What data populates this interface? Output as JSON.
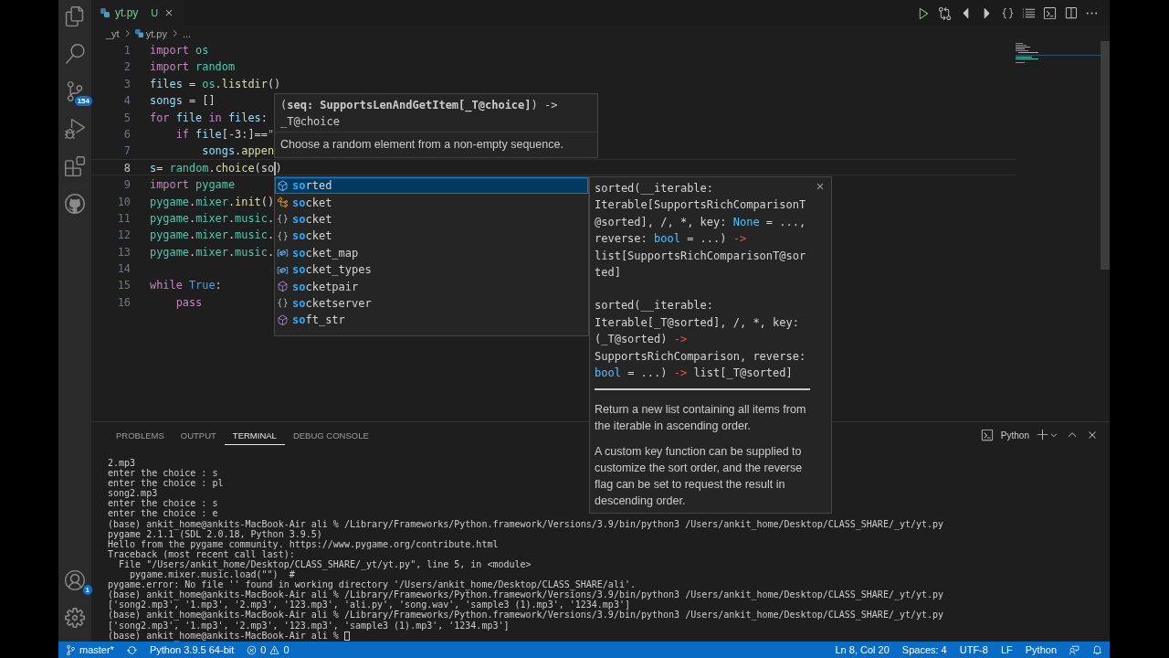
{
  "activity_bar": {
    "source_control_badge": "154",
    "accounts_badge": "1"
  },
  "tabs": [
    {
      "label": "yt.py",
      "status": "U",
      "selected": true
    }
  ],
  "breadcrumb": [
    "_yt",
    "yt.py",
    "..."
  ],
  "editor": {
    "lines": [
      {
        "number": "1",
        "current": false,
        "tokens": [
          {
            "kind": "keyword",
            "text": "import"
          },
          {
            "kind": "module",
            "text": " os"
          }
        ]
      },
      {
        "number": "2",
        "current": false,
        "tokens": [
          {
            "kind": "keyword",
            "text": "import"
          },
          {
            "kind": "module",
            "text": " random"
          }
        ]
      },
      {
        "number": "3",
        "current": false,
        "tokens": [
          {
            "kind": "variable",
            "text": "files"
          },
          {
            "kind": "plain",
            "text": " = "
          },
          {
            "kind": "module",
            "text": "os"
          },
          {
            "kind": "plain",
            "text": "."
          },
          {
            "kind": "function",
            "text": "listdir"
          },
          {
            "kind": "plain",
            "text": "()"
          }
        ]
      },
      {
        "number": "4",
        "current": false,
        "tokens": [
          {
            "kind": "variable",
            "text": "songs"
          },
          {
            "kind": "plain",
            "text": " = []"
          }
        ]
      },
      {
        "number": "5",
        "current": false,
        "tokens": [
          {
            "kind": "keyword",
            "text": "for"
          },
          {
            "kind": "variable",
            "text": " file"
          },
          {
            "kind": "keyword",
            "text": " in"
          },
          {
            "kind": "variable",
            "text": " files"
          },
          {
            "kind": "plain",
            "text": ":"
          }
        ]
      },
      {
        "number": "6",
        "current": false,
        "tokens": [
          {
            "kind": "keyword",
            "text": "    if"
          },
          {
            "kind": "variable",
            "text": " file"
          },
          {
            "kind": "plain",
            "text": "[-3:]=="
          },
          {
            "kind": "string",
            "text": "\""
          }
        ]
      },
      {
        "number": "7",
        "current": false,
        "tokens": [
          {
            "kind": "variable",
            "text": "        songs"
          },
          {
            "kind": "plain",
            "text": "."
          },
          {
            "kind": "function",
            "text": "appen"
          }
        ]
      },
      {
        "number": "8",
        "current": true,
        "tokens": [
          {
            "kind": "variable",
            "text": "s"
          },
          {
            "kind": "plain",
            "text": "= "
          },
          {
            "kind": "module",
            "text": "random"
          },
          {
            "kind": "plain",
            "text": "."
          },
          {
            "kind": "function",
            "text": "choice"
          },
          {
            "kind": "plain",
            "text": "(so"
          },
          {
            "kind": "cursor"
          },
          {
            "kind": "plain",
            "text": ")"
          }
        ]
      },
      {
        "number": "9",
        "current": false,
        "tokens": [
          {
            "kind": "keyword",
            "text": "import"
          },
          {
            "kind": "module",
            "text": " pygame"
          }
        ]
      },
      {
        "number": "10",
        "current": false,
        "tokens": [
          {
            "kind": "module",
            "text": "pygame"
          },
          {
            "kind": "plain",
            "text": "."
          },
          {
            "kind": "module",
            "text": "mixer"
          },
          {
            "kind": "plain",
            "text": "."
          },
          {
            "kind": "function",
            "text": "init"
          },
          {
            "kind": "plain",
            "text": "()"
          }
        ]
      },
      {
        "number": "11",
        "current": false,
        "tokens": [
          {
            "kind": "module",
            "text": "pygame"
          },
          {
            "kind": "plain",
            "text": "."
          },
          {
            "kind": "module",
            "text": "mixer"
          },
          {
            "kind": "plain",
            "text": "."
          },
          {
            "kind": "module",
            "text": "music"
          },
          {
            "kind": "plain",
            "text": "."
          }
        ]
      },
      {
        "number": "12",
        "current": false,
        "tokens": [
          {
            "kind": "module",
            "text": "pygame"
          },
          {
            "kind": "plain",
            "text": "."
          },
          {
            "kind": "module",
            "text": "mixer"
          },
          {
            "kind": "plain",
            "text": "."
          },
          {
            "kind": "module",
            "text": "music"
          },
          {
            "kind": "plain",
            "text": "."
          }
        ]
      },
      {
        "number": "13",
        "current": false,
        "tokens": [
          {
            "kind": "module",
            "text": "pygame"
          },
          {
            "kind": "plain",
            "text": "."
          },
          {
            "kind": "module",
            "text": "mixer"
          },
          {
            "kind": "plain",
            "text": "."
          },
          {
            "kind": "module",
            "text": "music"
          },
          {
            "kind": "plain",
            "text": "."
          }
        ]
      },
      {
        "number": "14",
        "current": false
      },
      {
        "number": "15",
        "current": false,
        "tokens": [
          {
            "kind": "keyword",
            "text": "while"
          },
          {
            "kind": "constant",
            "text": " True"
          },
          {
            "kind": "plain",
            "text": ":"
          }
        ]
      },
      {
        "number": "16",
        "current": false,
        "tokens": [
          {
            "kind": "keyword",
            "text": "    pass"
          }
        ]
      }
    ]
  },
  "signature_help": {
    "signature": "(**seq: SupportsLenAndGetItem[_T@choice]**) -> _T@choice",
    "description": "Choose a random element from a non-empty sequence."
  },
  "suggestions": [
    {
      "match": "so",
      "rest": "rted",
      "kind": "method",
      "selected": true
    },
    {
      "match": "so",
      "rest": "cket",
      "kind": "class",
      "selected": false
    },
    {
      "match": "so",
      "rest": "cket",
      "kind": "module",
      "selected": false
    },
    {
      "match": "so",
      "rest": "cket",
      "kind": "module",
      "selected": false
    },
    {
      "match": "so",
      "rest": "cket_map",
      "kind": "variable",
      "selected": false
    },
    {
      "match": "so",
      "rest": "cket_types",
      "kind": "variable",
      "selected": false
    },
    {
      "match": "so",
      "rest": "cketpair",
      "kind": "method",
      "selected": false
    },
    {
      "match": "so",
      "rest": "cketserver",
      "kind": "module",
      "selected": false
    },
    {
      "match": "so",
      "rest": "ft_str",
      "kind": "method",
      "selected": false
    }
  ],
  "suggestion_details": {
    "signatures": [
      [
        [
          {
            "kind": "plain",
            "text": "sorted(__iterable:"
          }
        ],
        [
          {
            "kind": "plain",
            "text": "Iterable[SupportsRichComparisonT"
          }
        ],
        [
          {
            "kind": "plain",
            "text": "@sorted], /, *, key: "
          },
          {
            "kind": "type",
            "text": "None"
          },
          {
            "kind": "plain",
            "text": " = ...,"
          }
        ],
        [
          {
            "kind": "plain",
            "text": "reverse: "
          },
          {
            "kind": "type",
            "text": "bool"
          },
          {
            "kind": "plain",
            "text": " = ...) "
          },
          {
            "kind": "arrow",
            "text": "->"
          }
        ],
        [
          {
            "kind": "plain",
            "text": "list[SupportsRichComparisonT@sor"
          }
        ],
        [
          {
            "kind": "plain",
            "text": "ted]"
          }
        ]
      ],
      [
        [
          {
            "kind": "plain",
            "text": "sorted(__iterable:"
          }
        ],
        [
          {
            "kind": "plain",
            "text": "Iterable[_T@sorted], /, *, key:"
          }
        ],
        [
          {
            "kind": "plain",
            "text": "(_T@sorted) "
          },
          {
            "kind": "arrow",
            "text": "->"
          }
        ],
        [
          {
            "kind": "plain",
            "text": "SupportsRichComparison, reverse:"
          }
        ],
        [
          {
            "kind": "type",
            "text": "bool"
          },
          {
            "kind": "plain",
            "text": " = ...) "
          },
          {
            "kind": "arrow",
            "text": "->"
          },
          {
            "kind": "plain",
            "text": " list[_T@sorted]"
          }
        ]
      ]
    ],
    "paragraphs": [
      "Return a new list containing all items from the iterable in ascending order.",
      "A custom key function can be supplied to customize the sort order, and the reverse flag can be set to request the result in descending order."
    ]
  },
  "panel": {
    "tabs": [
      {
        "label": "PROBLEMS",
        "selected": false
      },
      {
        "label": "OUTPUT",
        "selected": false
      },
      {
        "label": "TERMINAL",
        "selected": true
      },
      {
        "label": "DEBUG CONSOLE",
        "selected": false
      }
    ],
    "terminal_name": "Python",
    "terminal_lines": [
      "2.mp3",
      "enter the choice : s",
      "enter the choice : pl",
      "song2.mp3",
      "enter the choice : s",
      "enter the choice : e",
      "(base) ankit_home@ankits-MacBook-Air ali % /Library/Frameworks/Python.framework/Versions/3.9/bin/python3 /Users/ankit_home/Desktop/CLASS_SHARE/_yt/yt.py",
      "pygame 2.1.1 (SDL 2.0.18, Python 3.9.5)",
      "Hello from the pygame community. https://www.pygame.org/contribute.html",
      "Traceback (most recent call last):",
      "  File \"/Users/ankit_home/Desktop/CLASS_SHARE/_yt/yt.py\", line 5, in <module>",
      "    pygame.mixer.music.load(\"\")  #",
      "pygame.error: No file '' found in working directory '/Users/ankit_home/Desktop/CLASS_SHARE/ali'.",
      "(base) ankit_home@ankits-MacBook-Air ali % /Library/Frameworks/Python.framework/Versions/3.9/bin/python3 /Users/ankit_home/Desktop/CLASS_SHARE/_yt/yt.py",
      "['song2.mp3', '1.mp3', '2.mp3', '123.mp3', 'ali.py', 'song.wav', 'sample3 (1).mp3', '1234.mp3']",
      "(base) ankit_home@ankits-MacBook-Air ali % /Library/Frameworks/Python.framework/Versions/3.9/bin/python3 /Users/ankit_home/Desktop/CLASS_SHARE/_yt/yt.py",
      "['song2.mp3', '1.mp3', '2.mp3', '123.mp3', 'sample3 (1).mp3', '1234.mp3']",
      "(base) ankit_home@ankits-MacBook-Air ali % "
    ]
  },
  "status_bar": {
    "branch": "master*",
    "interpreter": "Python 3.9.5 64-bit",
    "errors": "0",
    "warnings": "0",
    "position": "Ln 8, Col 20",
    "indentation": "Spaces: 4",
    "encoding": "UTF-8",
    "eol": "LF",
    "language": "Python"
  }
}
